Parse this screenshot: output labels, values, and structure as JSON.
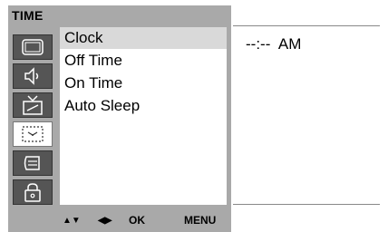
{
  "menu": {
    "title": "TIME",
    "categories": [
      {
        "icon": "picture-icon"
      },
      {
        "icon": "sound-icon"
      },
      {
        "icon": "station-icon"
      },
      {
        "icon": "time-icon",
        "selected": true
      },
      {
        "icon": "special-icon"
      },
      {
        "icon": "lock-icon"
      }
    ],
    "items": [
      {
        "label": "Clock",
        "highlighted": true
      },
      {
        "label": "Off Time"
      },
      {
        "label": "On Time"
      },
      {
        "label": "Auto Sleep"
      }
    ]
  },
  "value": {
    "clock_display": "--:--  AM"
  },
  "nav": {
    "updown": "▲▼",
    "leftright": "◀▶",
    "ok": "OK",
    "menu": "MENU"
  },
  "colors": {
    "frame": "#a9a9a9",
    "icon_tile": "#555555",
    "highlight": "#d9d9d9"
  }
}
